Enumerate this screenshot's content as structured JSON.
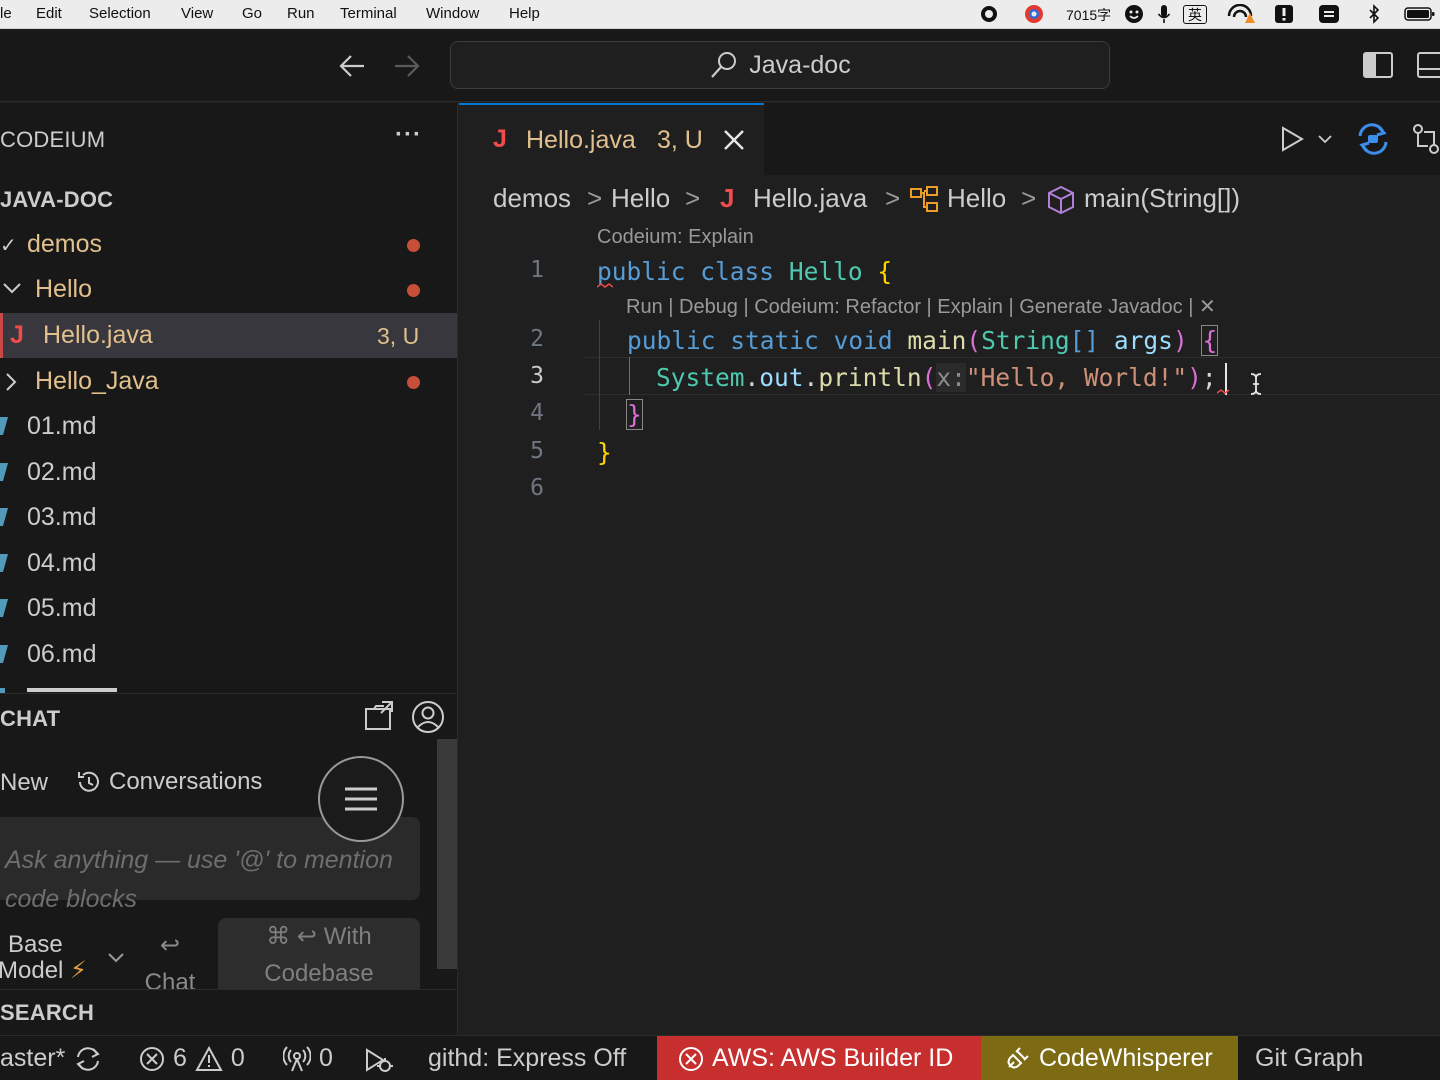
{
  "colors": {
    "accent": "#0078d4",
    "aws_bg": "#c72e2e",
    "codewhisperer_bg": "#7d6b14",
    "modified": "#e2c08d",
    "java_icon": "#f14c4c"
  },
  "menubar": {
    "items": [
      "le",
      "Edit",
      "Selection",
      "View",
      "Go",
      "Run",
      "Terminal",
      "Window",
      "Help"
    ],
    "word_count": "7015字",
    "ime": "英"
  },
  "titlebar": {
    "search_label": "Java-doc"
  },
  "sidebar": {
    "codeium_title": "CODEIUM",
    "more_label": "···",
    "workspace_title": "JAVA-DOC",
    "tree": [
      {
        "label": "demos",
        "chevron": "✓"
      },
      {
        "label": "Hello",
        "chevron": "∨"
      },
      {
        "label": "Hello.java",
        "badge": "3, U"
      },
      {
        "label": "Hello_Java",
        "chevron": ">"
      },
      {
        "label": "01.md"
      },
      {
        "label": "02.md"
      },
      {
        "label": "03.md"
      },
      {
        "label": "04.md"
      },
      {
        "label": "05.md"
      },
      {
        "label": "06.md"
      }
    ],
    "chat": {
      "title": "CHAT",
      "new_label": "New",
      "conversations_label": "Conversations",
      "input_placeholder": "Ask anything — use '@' to mention code blocks",
      "model_line1": "Base",
      "model_line2": "Model",
      "model_bolt": "⚡",
      "chat_key": "↩",
      "chat_label": "Chat",
      "codebase_line1": "⌘ ↩ With",
      "codebase_line2": "Codebase"
    },
    "search_title": "SEARCH"
  },
  "editor": {
    "tab": {
      "name": "Hello.java",
      "badge": "3, U",
      "icon": "J"
    },
    "breadcrumbs": [
      "demos",
      "Hello",
      "Hello.java",
      "Hello",
      "main(String[])"
    ],
    "codelens_class": "Codeium: Explain",
    "codelens_method": "Run | Debug | Codeium: Refactor | Explain | Generate Javadoc | ✕",
    "line_numbers": [
      "1",
      "2",
      "3",
      "4",
      "5",
      "6"
    ],
    "code": {
      "l1_kw1": "public",
      "l1_kw2": "class",
      "l1_name": "Hello",
      "l1_brace": "{",
      "l2_kw1": "public",
      "l2_kw2": "static",
      "l2_kw3": "void",
      "l2_fn": "main",
      "l2_paren_open": "(",
      "l2_type": "String",
      "l2_arr": "[]",
      "l2_arg": "args",
      "l2_paren_close": ")",
      "l2_brace": "{",
      "l3_sys": "System",
      "l3_dot1": ".",
      "l3_out": "out",
      "l3_dot2": ".",
      "l3_fn": "println",
      "l3_paren_open": "(",
      "l3_hint": "x:",
      "l3_str": "\"Hello, World!\"",
      "l3_paren_close": ")",
      "l3_semi": ";",
      "l4_brace": "}",
      "l5_brace": "}"
    }
  },
  "statusbar": {
    "branch": "aster*",
    "errors": "6",
    "warnings": "0",
    "ports": "0",
    "githd": "githd: Express Off",
    "aws": "AWS: AWS Builder ID",
    "codewhisperer": "CodeWhisperer",
    "gitgraph": "Git Graph"
  }
}
